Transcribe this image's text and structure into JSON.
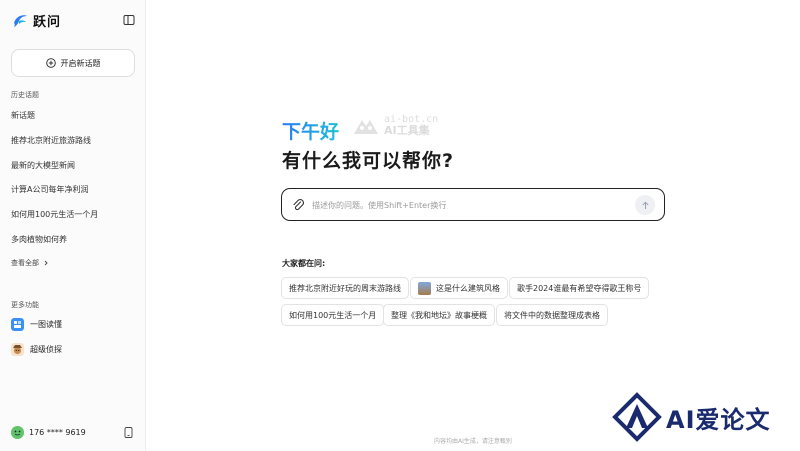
{
  "app": {
    "name": "跃问"
  },
  "sidebar": {
    "new_topic_label": "开启新话题",
    "history_label": "历史话题",
    "history_items": [
      "新话题",
      "推荐北京附近旅游路线",
      "最新的大模型新闻",
      "计算A公司每年净利润",
      "如何用100元生活一个月",
      "多肉植物如何养"
    ],
    "view_all_label": "查看全部",
    "more_features_label": "更多功能",
    "features": [
      {
        "label": "一图读懂",
        "icon": "picture-book-icon",
        "color": "#3b8ff5"
      },
      {
        "label": "超级侦探",
        "icon": "detective-avatar-icon",
        "color": "#c98a4b"
      }
    ],
    "user_phone": "176 **** 9619"
  },
  "main": {
    "greeting": "下午好",
    "watermark_line1": "ai-bot.cn",
    "watermark_line2": "AI工具集",
    "headline": "有什么我可以帮你?",
    "input_placeholder": "描述你的问题。使用Shift+Enter换行",
    "asking_label": "大家都在问:",
    "suggestions_row1": [
      "推荐北京附近好玩的周末游路线",
      "这是什么建筑风格",
      "歌手2024谁最有希望夺得歌王称号"
    ],
    "suggestions_row2": [
      "如何用100元生活一个月",
      "整理《我和地坛》故事梗概",
      "将文件中的数据整理成表格"
    ],
    "footer_note": "内容均由AI生成，请注意甄别"
  },
  "corner_brand": {
    "text": "AI爱论文",
    "color": "#1a2a6e"
  },
  "colors": {
    "accent_start": "#2b7cf6",
    "accent_end": "#1dbfd6"
  }
}
